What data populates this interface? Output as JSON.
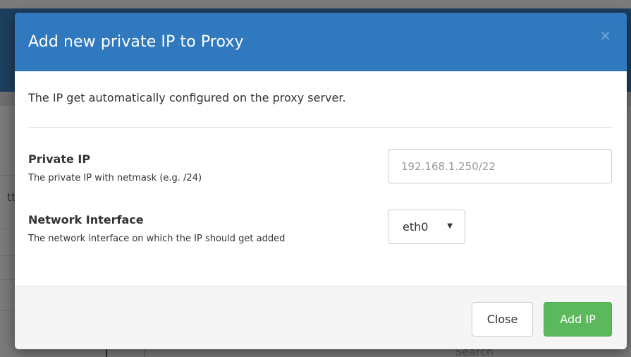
{
  "background": {
    "left_fragment": "tt",
    "search_fragment": "Search"
  },
  "modal": {
    "title": "Add new private IP to Proxy",
    "close_glyph": "×",
    "intro": "The IP get automatically configured on the proxy server.",
    "fields": {
      "private_ip": {
        "label": "Private IP",
        "help": "The private IP with netmask (e.g. /24)",
        "placeholder": "192.168.1.250/22",
        "value": ""
      },
      "network_interface": {
        "label": "Network Interface",
        "help": "The network interface on which the IP should get added",
        "selected": "eth0",
        "caret": "▼"
      }
    },
    "footer": {
      "close_label": "Close",
      "add_label": "Add IP"
    }
  },
  "colors": {
    "header_bg": "#3079bf",
    "primary_button": "#5cb85c",
    "backdrop": "#7b7b7b"
  },
  "icons": {
    "close": "close-icon",
    "caret": "chevron-down-icon"
  }
}
